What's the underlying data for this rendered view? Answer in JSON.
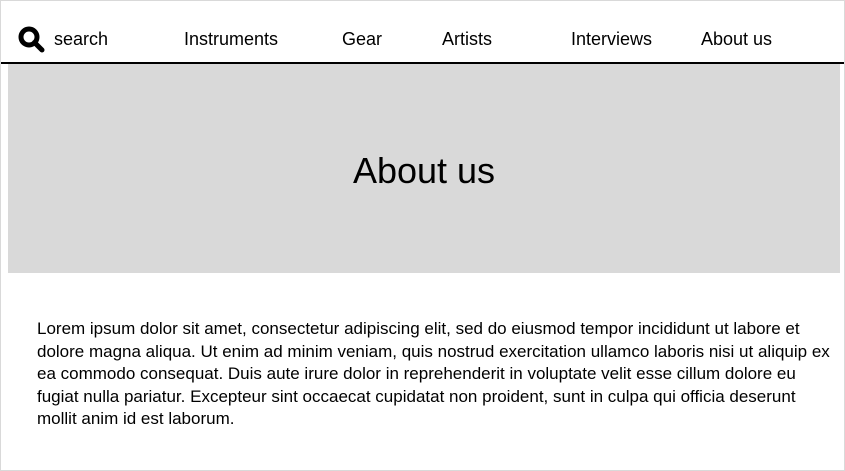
{
  "nav": {
    "search": {
      "icon": "search-icon",
      "label": "search"
    },
    "items": [
      {
        "label": "Instruments"
      },
      {
        "label": "Gear"
      },
      {
        "label": "Artists"
      },
      {
        "label": "Interviews"
      },
      {
        "label": "About us"
      }
    ]
  },
  "hero": {
    "title": "About us",
    "background_color": "#d9d9d9"
  },
  "content": {
    "paragraph": "Lorem ipsum dolor sit amet, consectetur adipiscing elit, sed do eiusmod tempor incididunt ut labore et dolore magna aliqua. Ut enim ad minim veniam, quis nostrud exercitation ullamco laboris nisi ut aliquip ex ea commodo consequat. Duis aute irure dolor in reprehenderit in voluptate velit esse cillum dolore eu fugiat nulla pariatur. Excepteur sint occaecat cupidatat non proident, sunt in culpa qui officia deserunt mollit anim id est laborum."
  }
}
